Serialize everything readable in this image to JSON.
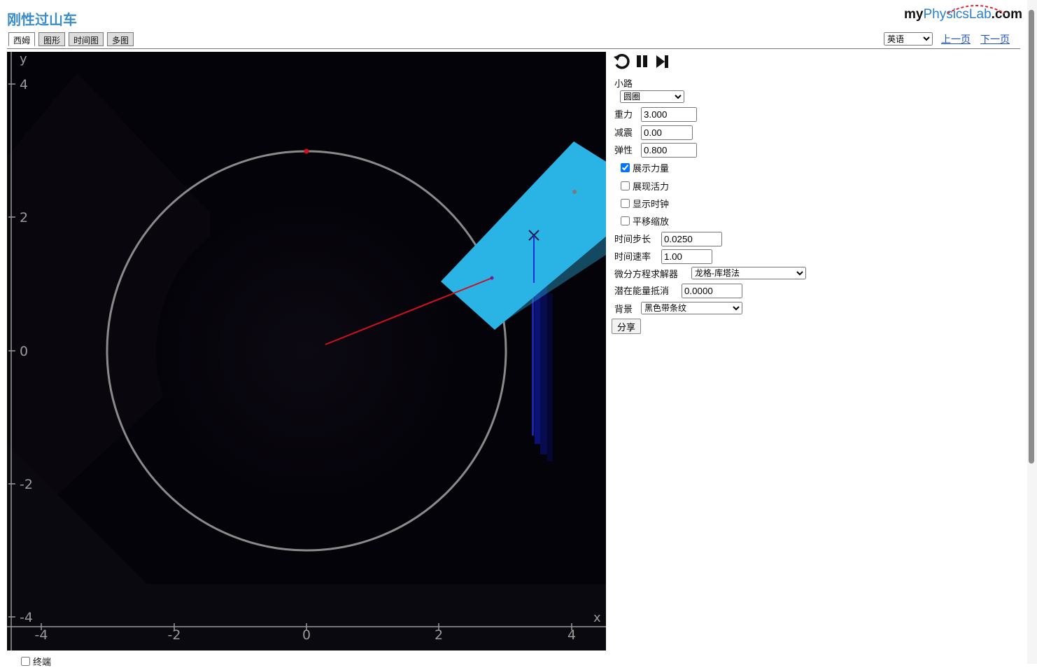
{
  "app": {
    "title": "刚性过山车"
  },
  "logo": {
    "part1": "my",
    "part2": "PhysicsLab",
    "part3": ".com"
  },
  "tabs": [
    {
      "label": "西姆"
    },
    {
      "label": "图形"
    },
    {
      "label": "时间图"
    },
    {
      "label": "多图"
    }
  ],
  "language": {
    "selected": "英语"
  },
  "nav": {
    "prev": "上一页",
    "next": "下一页"
  },
  "graph": {
    "x_axis_label": "x",
    "y_axis_label": "y",
    "x_ticks": [
      "-4",
      "-2",
      "0",
      "2",
      "4"
    ],
    "y_ticks": [
      "4",
      "2",
      "0",
      "-2",
      "-4"
    ],
    "colors": {
      "track": "#8a8a8a",
      "block": "#2ab4e6",
      "spring": "#d0101e",
      "force": "#1a2cd8",
      "background": "#05030a"
    }
  },
  "controls": {
    "icons": [
      "reset-icon",
      "pause-icon",
      "step-icon"
    ],
    "path_label": "小路",
    "path_value": "圆圈",
    "gravity_label": "重力",
    "gravity_value": "3.000",
    "damping_label": "减震",
    "damping_value": "0.00",
    "elasticity_label": "弹性",
    "elasticity_value": "0.800",
    "show_forces_label": "展示力量",
    "show_energy_label": "展现活力",
    "show_clock_label": "显示时钟",
    "pan_zoom_label": "平移缩放",
    "time_step_label": "时间步长",
    "time_step_value": "0.0250",
    "time_rate_label": "时间速率",
    "time_rate_value": "1.00",
    "solver_label": "微分方程求解器",
    "solver_value": "龙格-库塔法",
    "pe_offset_label": "潜在能量抵消",
    "pe_offset_value": "0.0000",
    "background_label": "背景",
    "background_value": "黑色带条纹",
    "share_label": "分享"
  },
  "footer": {
    "terminal_label": "终端"
  }
}
